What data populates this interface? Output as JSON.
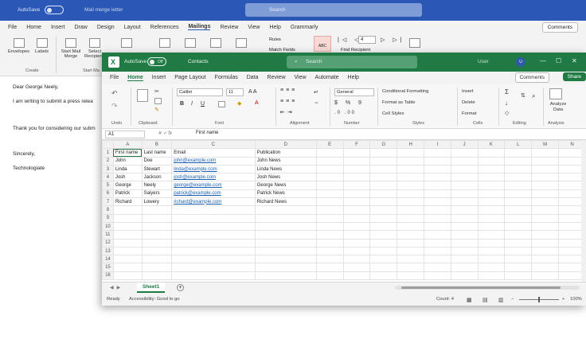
{
  "word": {
    "autosave": "AutoSave",
    "doc_title": "Mail merge letter",
    "search": "Search",
    "menu": [
      "File",
      "Home",
      "Insert",
      "Draw",
      "Design",
      "Layout",
      "References",
      "Mailings",
      "Review",
      "View",
      "Help",
      "Grammarly"
    ],
    "comments": "Comments",
    "ribbon": {
      "envelopes": "Envelopes",
      "labels": "Labels",
      "create": "Create",
      "start_mail_merge": "Start Mail Merge",
      "select_recipients": "Select Recipients",
      "start_mail": "Start Ma",
      "rules": "Rules",
      "match_fields": "Match Fields",
      "find_recipient": "Find Recipient",
      "record": "4"
    },
    "lines": [
      "Dear George Neely,",
      "I am writing to submit a press relea",
      "Thank you for considering our subm",
      "Sincerely,",
      "Technologiate"
    ]
  },
  "excel": {
    "autosave": "AutoSave",
    "autosave_state": "Off",
    "doc_name": "Contacts",
    "search": "Search",
    "user": "User",
    "avatar": "U",
    "menu": [
      "File",
      "Home",
      "Insert",
      "Page Layout",
      "Formulas",
      "Data",
      "Review",
      "View",
      "Automate",
      "Help"
    ],
    "comments": "Comments",
    "share": "Share",
    "ribbon": {
      "font_name": "Calibri",
      "font_size": "11",
      "number_format": "General",
      "conditional_formatting": "Conditional Formatting",
      "format_as_table": "Format as Table",
      "cell_styles": "Cell Styles",
      "insert": "Insert",
      "delete": "Delete",
      "format": "Format",
      "analyze_data": "Analyze Data",
      "groups": [
        "Undo",
        "Clipboard",
        "Font",
        "Alignment",
        "Number",
        "Styles",
        "Cells",
        "Editing",
        "Analysis"
      ]
    },
    "namebox": "A1",
    "formula": "First name",
    "columns": [
      "A",
      "B",
      "C",
      "D",
      "E",
      "F",
      "G",
      "H",
      "I",
      "J",
      "K",
      "L",
      "M",
      "N"
    ],
    "rows": [
      [
        "First name",
        "Last name",
        "Email",
        "Publication"
      ],
      [
        "John",
        "Doe",
        "john@example.com",
        "John News"
      ],
      [
        "Linda",
        "Stewart",
        "linda@example.com",
        "Linda News"
      ],
      [
        "Josh",
        "Jackson",
        "josh@example.com",
        "Josh News"
      ],
      [
        "George",
        "Neely",
        "george@example.com",
        "George News"
      ],
      [
        "Patrick",
        "Saiyers",
        "patrick@example.com",
        "Patrick News"
      ],
      [
        "Richard",
        "Lowery",
        "richard@example.com",
        "Richard News"
      ]
    ],
    "total_rows": 16,
    "sheet_tab": "Sheet1",
    "status": {
      "ready": "Ready",
      "accessibility": "Accessibility: Good to go",
      "count": "Count: 4",
      "zoom": "100%"
    }
  }
}
